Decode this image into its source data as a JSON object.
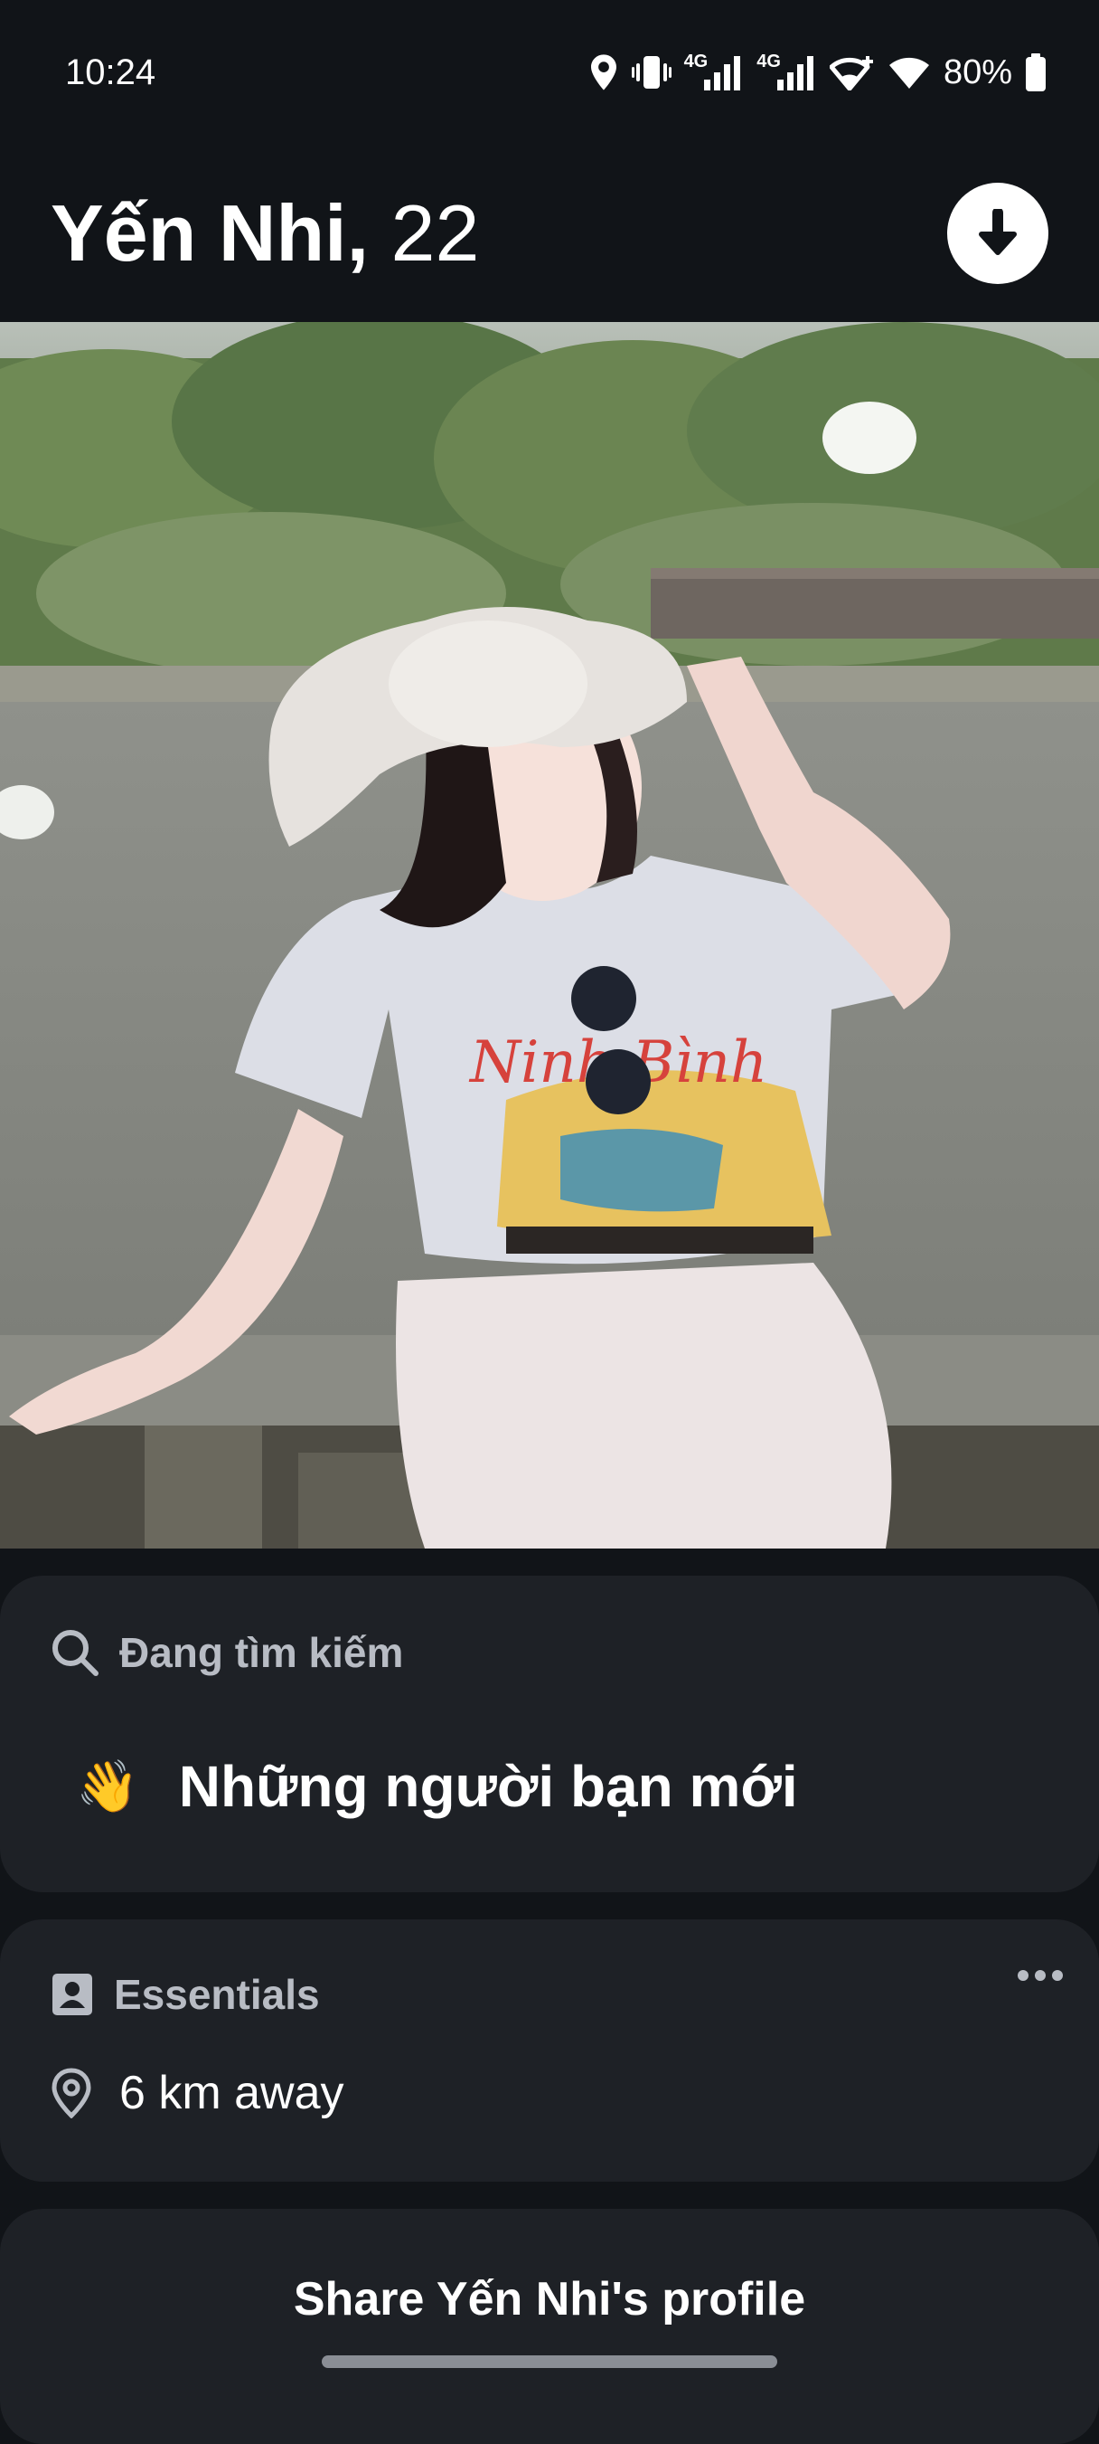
{
  "status_bar": {
    "time": "10:24",
    "network_1": "4G",
    "network_2": "4G",
    "battery": "80%",
    "icons": [
      "location-icon",
      "vibrate-icon",
      "signal-icon",
      "signal-icon",
      "wifi-plus-icon",
      "wifi-icon",
      "battery-icon"
    ]
  },
  "profile": {
    "name": "Yến Nhi,",
    "age": "22",
    "download_icon": "arrow-down-icon"
  },
  "looking_for": {
    "label": "Đang tìm kiếm",
    "emoji": "👋",
    "value": "Những người bạn mới"
  },
  "essentials": {
    "label": "Essentials",
    "distance": "6 km away"
  },
  "share": {
    "label": "Share Yến Nhi's profile"
  },
  "colors": {
    "background": "#111418",
    "card": "#1e2126",
    "label_gray": "#b8bcc4"
  }
}
